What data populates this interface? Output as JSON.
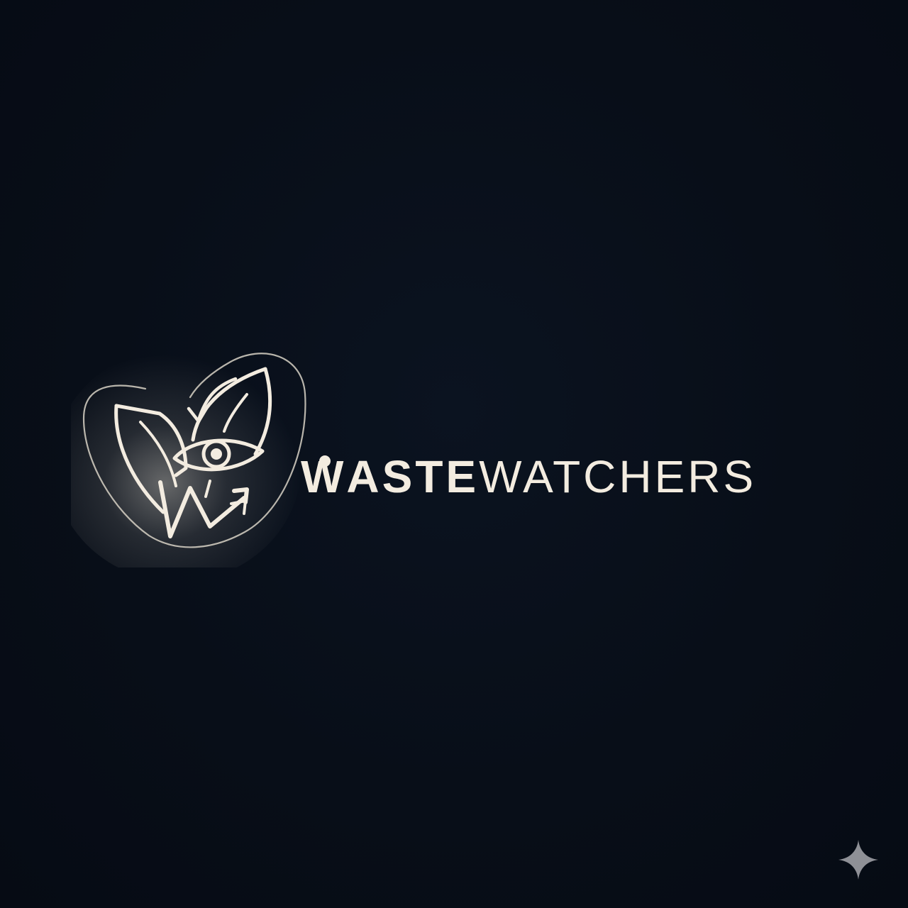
{
  "brand": {
    "name_first_letter": "W",
    "name_bold_rest": "ASTE",
    "name_light": "WATCHERS",
    "text_color": "#f3ece0",
    "glow_color": "#fff8ea"
  },
  "logo": {
    "icons": [
      "leaf-icon",
      "eye-icon",
      "recycle-arrow-icon",
      "trend-arrow-icon"
    ]
  },
  "colors": {
    "background": "#070d17",
    "sparkle": "#8e9096"
  },
  "watermark": {
    "icon": "sparkle-icon"
  }
}
